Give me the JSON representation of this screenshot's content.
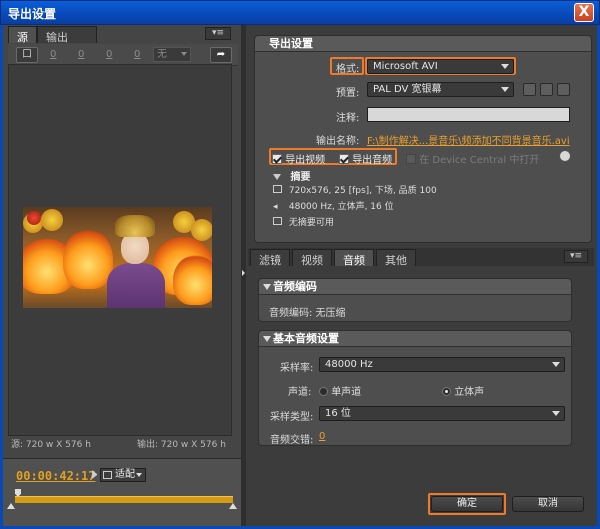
{
  "window": {
    "title": "导出设置",
    "close_label": "X"
  },
  "source_panel": {
    "tabs": [
      "源",
      "输出"
    ],
    "toolbar": {
      "crop_label": "口",
      "values": [
        "0",
        "0",
        "0",
        "0"
      ],
      "dropdown": "无"
    },
    "source_size": "源: 720 w X 576 h",
    "output_size": "输出: 720 w X 576 h",
    "timecode": "00:00:42:17",
    "fit_label": "适配"
  },
  "export_settings": {
    "header": "导出设置",
    "format_label": "格式:",
    "format_value": "Microsoft AVI",
    "preset_label": "预置:",
    "preset_value": "PAL DV 宽银幕",
    "comment_label": "注释:",
    "comment_value": "",
    "output_name_label": "输出名称:",
    "output_name_value": "F:\\制作解决...景音乐\\频添加不同背景音乐.avi",
    "export_video_label": "导出视频",
    "export_audio_label": "导出音频",
    "device_central_label": "在 Device Central 中打开",
    "summary_header": "摘要",
    "summary_video": "720x576, 25 [fps], 下场, 品质 100",
    "summary_audio": "48000 Hz, 立体声, 16 位",
    "summary_none": "无摘要可用"
  },
  "tabs": [
    "滤镜",
    "视频",
    "音频",
    "其他"
  ],
  "audio": {
    "codec_header": "音频编码",
    "codec_text": "音频编码: 无压缩",
    "basic_header": "基本音频设置",
    "sample_rate_label": "采样率:",
    "sample_rate_value": "48000 Hz",
    "channels_label": "声道:",
    "mono_label": "单声道",
    "stereo_label": "立体声",
    "sample_type_label": "采样类型:",
    "sample_type_value": "16 位",
    "interleave_label": "音频交错:",
    "interleave_value": "0"
  },
  "buttons": {
    "ok": "确定",
    "cancel": "取消"
  }
}
